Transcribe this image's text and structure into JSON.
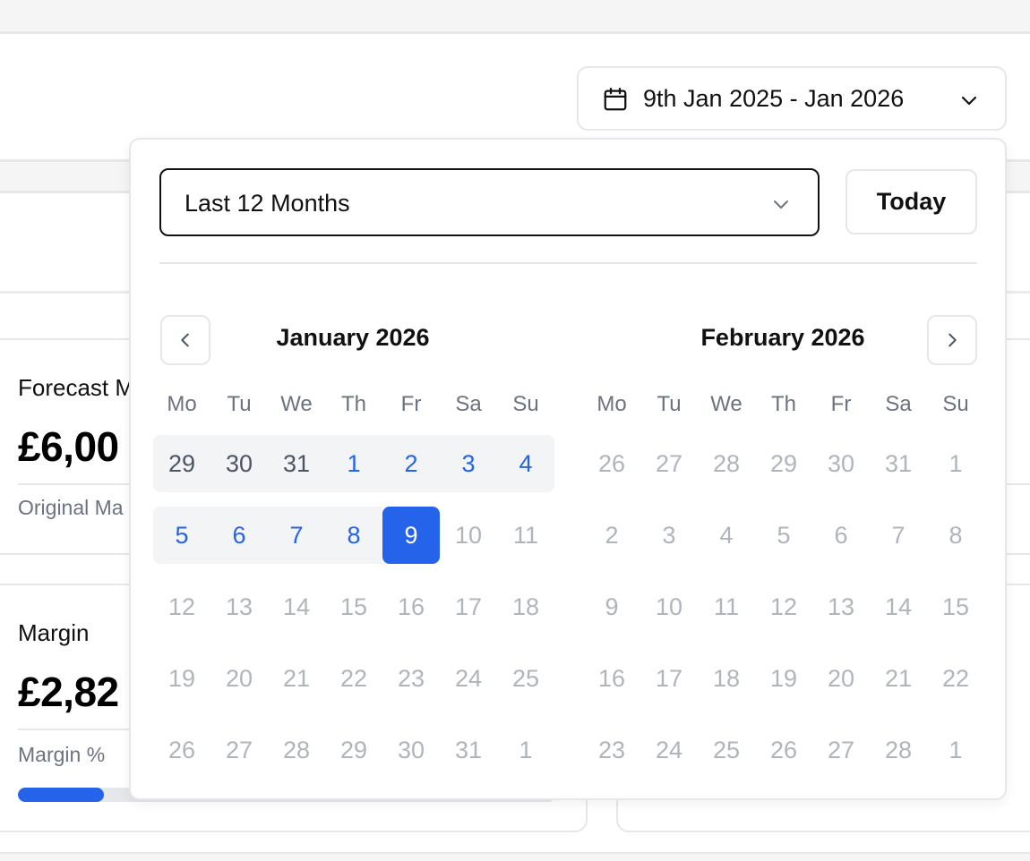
{
  "date_range": {
    "label": "9th Jan 2025 - Jan 2026"
  },
  "cards": [
    {
      "title": "Forecast M",
      "value": "£6,00",
      "sub": "Original Ma"
    },
    {
      "title": "Margin",
      "value": "£2,82",
      "sub": "Margin %",
      "progress_percent": 16
    }
  ],
  "picker": {
    "preset": "Last 12 Months",
    "today_label": "Today",
    "weekdays": [
      "Mo",
      "Tu",
      "We",
      "Th",
      "Fr",
      "Sa",
      "Su"
    ],
    "months": [
      {
        "title": "January 2026",
        "weeks": [
          [
            "29",
            "30",
            "31",
            "1",
            "2",
            "3",
            "4"
          ],
          [
            "5",
            "6",
            "7",
            "8",
            "9",
            "10",
            "11"
          ],
          [
            "12",
            "13",
            "14",
            "15",
            "16",
            "17",
            "18"
          ],
          [
            "19",
            "20",
            "21",
            "22",
            "23",
            "24",
            "25"
          ],
          [
            "26",
            "27",
            "28",
            "29",
            "30",
            "31",
            "1"
          ]
        ]
      },
      {
        "title": "February 2026",
        "weeks": [
          [
            "26",
            "27",
            "28",
            "29",
            "30",
            "31",
            "1"
          ],
          [
            "2",
            "3",
            "4",
            "5",
            "6",
            "7",
            "8"
          ],
          [
            "9",
            "10",
            "11",
            "12",
            "13",
            "14",
            "15"
          ],
          [
            "16",
            "17",
            "18",
            "19",
            "20",
            "21",
            "22"
          ],
          [
            "23",
            "24",
            "25",
            "26",
            "27",
            "28",
            "1"
          ]
        ]
      }
    ],
    "selected_day": "9",
    "colors": {
      "accent": "#2563eb",
      "range_bg": "#f3f4f6",
      "muted": "#b0b4bb"
    }
  },
  "icons": {
    "calendar": "calendar-icon",
    "chevron_down": "chevron-down-icon",
    "chevron_left": "chevron-left-icon",
    "chevron_right": "chevron-right-icon"
  }
}
